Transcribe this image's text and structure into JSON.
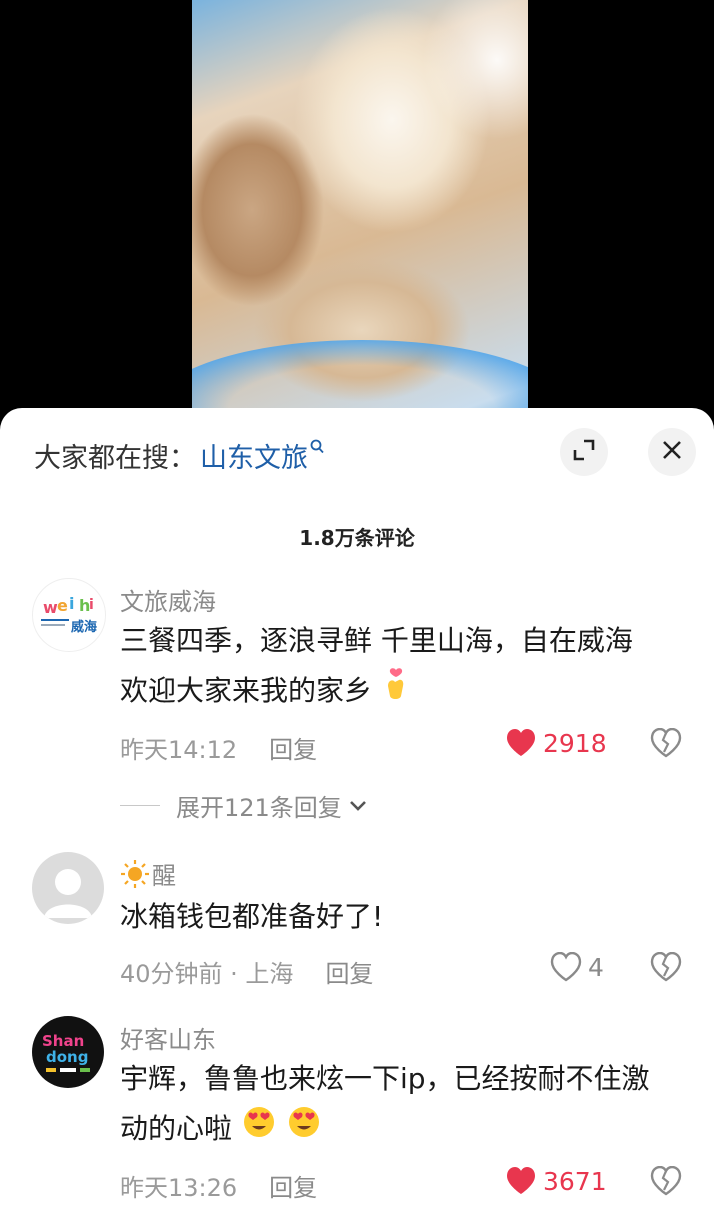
{
  "search": {
    "prefix": "大家都在搜：",
    "term": "山东文旅"
  },
  "comments_count": "1.8万条评论",
  "comments": [
    {
      "user": "文旅威海",
      "avatar_text": "威海",
      "lines": [
        "三餐四季，逐浪寻鲜 千里山海，自在威海",
        "欢迎大家来我的家乡"
      ],
      "time": "昨天14:12",
      "reply": "回复",
      "likes": "2918",
      "liked": true,
      "expand": "展开121条回复"
    },
    {
      "user": "醒",
      "user_prefix_icon": "sun-icon",
      "lines": [
        "冰箱钱包都准备好了!"
      ],
      "time": "40分钟前 · 上海",
      "reply": "回复",
      "likes": "4",
      "liked": false
    },
    {
      "user": "好客山东",
      "avatar_text": "Shan dong",
      "lines": [
        "宇辉，鲁鲁也来炫一下ip，已经按耐不住激",
        "动的心啦"
      ],
      "time": "昨天13:26",
      "reply": "回复",
      "likes": "3671",
      "liked": true
    }
  ],
  "colors": {
    "link": "#1f5fa8",
    "like_red": "#e8364e",
    "secondary": "#9a9a9a"
  }
}
